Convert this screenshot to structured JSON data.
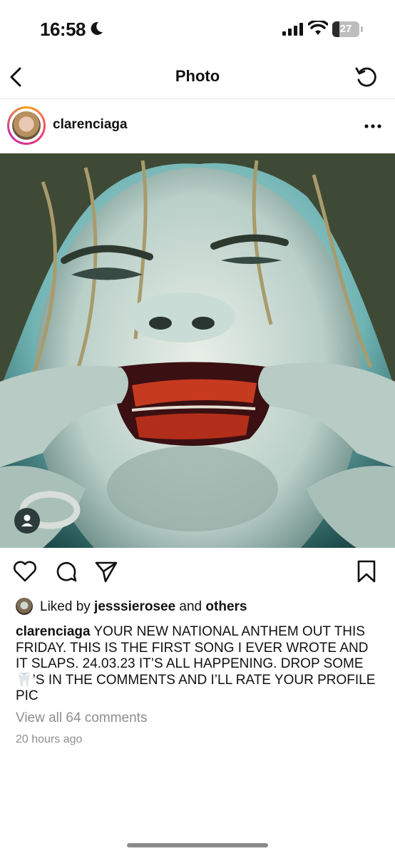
{
  "status_bar": {
    "time": "16:58",
    "battery": "27",
    "battery_level": 0.27
  },
  "nav": {
    "title": "Photo"
  },
  "post": {
    "username": "clarenciaga",
    "likes_prefix": "Liked by ",
    "liked_by": "jesssierosee",
    "likes_mid": " and ",
    "likes_others": "others",
    "caption_username": "clarenciaga",
    "caption_text": " YOUR NEW NATIONAL ANTHEM OUT THIS FRIDAY. THIS IS THE FIRST SONG I EVER WROTE AND IT SLAPS. 24.03.23 IT’S ALL HAPPENING. DROP SOME 🦷’S IN THE COMMENTS AND I’LL RATE YOUR PROFILE PIC",
    "view_comments": "View all 64 comments",
    "time_ago": "20 hours ago"
  },
  "icons": {
    "back": "chevron-left-icon",
    "refresh": "refresh-icon",
    "more": "more-horizontal-icon",
    "like": "heart-icon",
    "comment": "comment-icon",
    "share": "send-icon",
    "save": "bookmark-icon",
    "tag": "person-tag-icon"
  },
  "colors": {
    "accent_ring_start": "#f9a11b",
    "accent_ring_end": "#c12ea7",
    "secondary_text": "#8e8e8e"
  }
}
